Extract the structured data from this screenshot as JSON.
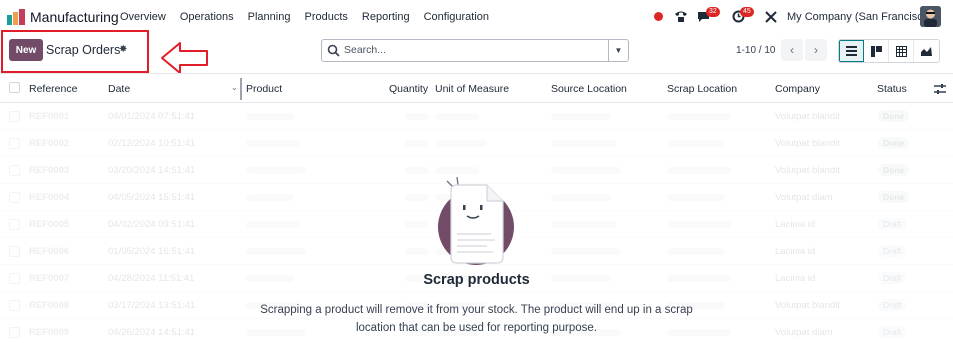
{
  "navbar": {
    "app_name": "Manufacturing",
    "menu": [
      "Overview",
      "Operations",
      "Planning",
      "Products",
      "Reporting",
      "Configuration"
    ],
    "messages_count": "32",
    "activities_count": "45",
    "company": "My Company (San Francisco)"
  },
  "control_panel": {
    "new_label": "New",
    "title": "Scrap Orders",
    "search_placeholder": "Search...",
    "pager": "1-10 / 10"
  },
  "table": {
    "headers": [
      "Reference",
      "Date",
      "Product",
      "Quantity",
      "Unit of Measure",
      "Source Location",
      "Scrap Location",
      "Company",
      "Status"
    ],
    "rows": [
      {
        "ref": "REF0001",
        "date": "04/01/2024 07:51:41",
        "company": "Volutpat blandit",
        "status": "Done"
      },
      {
        "ref": "REF0002",
        "date": "02/12/2024 10:51:41",
        "company": "Volutpat blandit",
        "status": "Done"
      },
      {
        "ref": "REF0003",
        "date": "03/20/2024 14:51:41",
        "company": "Volutpat blandit",
        "status": "Done"
      },
      {
        "ref": "REF0004",
        "date": "04/05/2024 15:51:41",
        "company": "Volutpat diam",
        "status": "Done"
      },
      {
        "ref": "REF0005",
        "date": "04/02/2024 09:51:41",
        "company": "Lacinia id",
        "status": "Draft"
      },
      {
        "ref": "REF0006",
        "date": "01/05/2024 16:51:41",
        "company": "Lacinia id",
        "status": "Draft"
      },
      {
        "ref": "REF0007",
        "date": "04/28/2024 11:51:41",
        "company": "Lacinia id",
        "status": "Draft"
      },
      {
        "ref": "REF0008",
        "date": "03/17/2024 13:51:41",
        "company": "Volutpat blandit",
        "status": "Draft"
      },
      {
        "ref": "REF0009",
        "date": "04/26/2024 14:51:41",
        "company": "Volutpat diam",
        "status": "Draft"
      }
    ]
  },
  "empty_state": {
    "title": "Scrap products",
    "text": "Scrapping a product will remove it from your stock. The product will end up in a scrap location that can be used for reporting purpose."
  },
  "colors": {
    "brand": "#714b67",
    "accent": "#017e84",
    "annotation": "#e11d2a"
  }
}
